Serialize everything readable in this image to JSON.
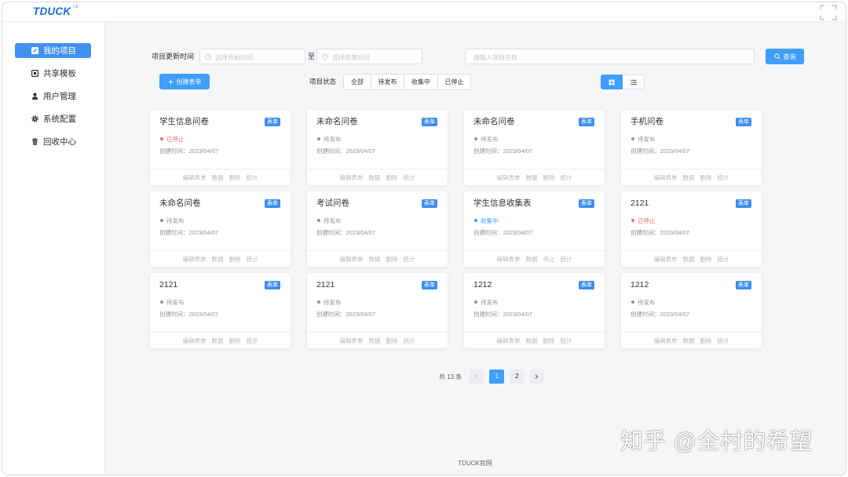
{
  "app": {
    "logo": "TDUCK",
    "logo_sup": "CE"
  },
  "header": {
    "icon": "fullscreen-icon"
  },
  "sidebar": {
    "items": [
      {
        "label": "我的项目",
        "icon": "edit-icon",
        "active": true
      },
      {
        "label": "共享模板",
        "icon": "template-icon",
        "active": false
      },
      {
        "label": "用户管理",
        "icon": "user-icon",
        "active": false
      },
      {
        "label": "系统配置",
        "icon": "gear-icon",
        "active": false
      },
      {
        "label": "回收中心",
        "icon": "trash-icon",
        "active": false
      }
    ]
  },
  "filters": {
    "update_time_label": "项目更新时间",
    "start_placeholder": "选择开始时间",
    "range_separator": "至",
    "end_placeholder": "选择结束时间",
    "name_placeholder": "请输入项目名称",
    "search_label": "查询",
    "date_icon": "clock-icon",
    "search_icon": "search-icon"
  },
  "toolbar": {
    "create_label": "创建表单",
    "create_icon": "plus-icon",
    "status_label": "项目状态",
    "status_options": [
      "全部",
      "待发布",
      "收集中",
      "已停止"
    ],
    "view_modes": [
      {
        "icon": "grid-icon",
        "active": true
      },
      {
        "icon": "list-icon",
        "active": false
      }
    ]
  },
  "card_labels": {
    "created_prefix": "创建时间："
  },
  "projects": [
    {
      "title": "学生信息问卷",
      "type": "表单",
      "status": "已停止",
      "status_color": "#f56c6c",
      "created_at": "2023/04/07",
      "actions": [
        "编辑表单",
        "数据",
        "删除",
        "统计"
      ]
    },
    {
      "title": "未命名问卷",
      "type": "表单",
      "status": "待发布",
      "status_color": "#909399",
      "created_at": "2023/04/07",
      "actions": [
        "编辑表单",
        "数据",
        "删除",
        "统计"
      ]
    },
    {
      "title": "未命名问卷",
      "type": "表单",
      "status": "待发布",
      "status_color": "#909399",
      "created_at": "2023/04/07",
      "actions": [
        "编辑表单",
        "数据",
        "删除",
        "统计"
      ]
    },
    {
      "title": "手机问卷",
      "type": "表单",
      "status": "待发布",
      "status_color": "#909399",
      "created_at": "2023/04/07",
      "actions": [
        "编辑表单",
        "数据",
        "删除",
        "统计"
      ]
    },
    {
      "title": "未命名问卷",
      "type": "表单",
      "status": "待发布",
      "status_color": "#909399",
      "created_at": "2023/04/07",
      "actions": [
        "编辑表单",
        "数据",
        "删除",
        "统计"
      ]
    },
    {
      "title": "考试问卷",
      "type": "表单",
      "status": "待发布",
      "status_color": "#909399",
      "created_at": "2023/04/07",
      "actions": [
        "编辑表单",
        "数据",
        "删除",
        "统计"
      ]
    },
    {
      "title": "学生信息收集表",
      "type": "表单",
      "status": "收集中",
      "status_color": "#409eff",
      "created_at": "2023/04/07",
      "actions": [
        "编辑表单",
        "数据",
        "停止",
        "统计"
      ]
    },
    {
      "title": "2121",
      "type": "表单",
      "status": "已停止",
      "status_color": "#f56c6c",
      "created_at": "2023/04/07",
      "actions": [
        "编辑表单",
        "数据",
        "删除",
        "统计"
      ]
    },
    {
      "title": "2121",
      "type": "表单",
      "status": "待发布",
      "status_color": "#909399",
      "created_at": "2023/04/07",
      "actions": [
        "编辑表单",
        "数据",
        "删除",
        "统计"
      ]
    },
    {
      "title": "2121",
      "type": "表单",
      "status": "待发布",
      "status_color": "#909399",
      "created_at": "2023/04/07",
      "actions": [
        "编辑表单",
        "数据",
        "删除",
        "统计"
      ]
    },
    {
      "title": "1212",
      "type": "表单",
      "status": "待发布",
      "status_color": "#909399",
      "created_at": "2023/04/07",
      "actions": [
        "编辑表单",
        "数据",
        "删除",
        "统计"
      ]
    },
    {
      "title": "1212",
      "type": "表单",
      "status": "待发布",
      "status_color": "#909399",
      "created_at": "2023/04/07",
      "actions": [
        "编辑表单",
        "数据",
        "删除",
        "统计"
      ]
    }
  ],
  "pagination": {
    "total": "共 13 条",
    "pages": [
      "1",
      "2"
    ],
    "current_page": "1",
    "prev_icon": "chevron-left-icon",
    "next_icon": "chevron-right-icon"
  },
  "footer": {
    "link_label": "TDUCK官网"
  },
  "watermark": "知乎 @全村的希望",
  "colors": {
    "primary": "#409eff",
    "danger": "#f56c6c",
    "muted": "#909399",
    "page_bg": "#f5f6f8"
  }
}
